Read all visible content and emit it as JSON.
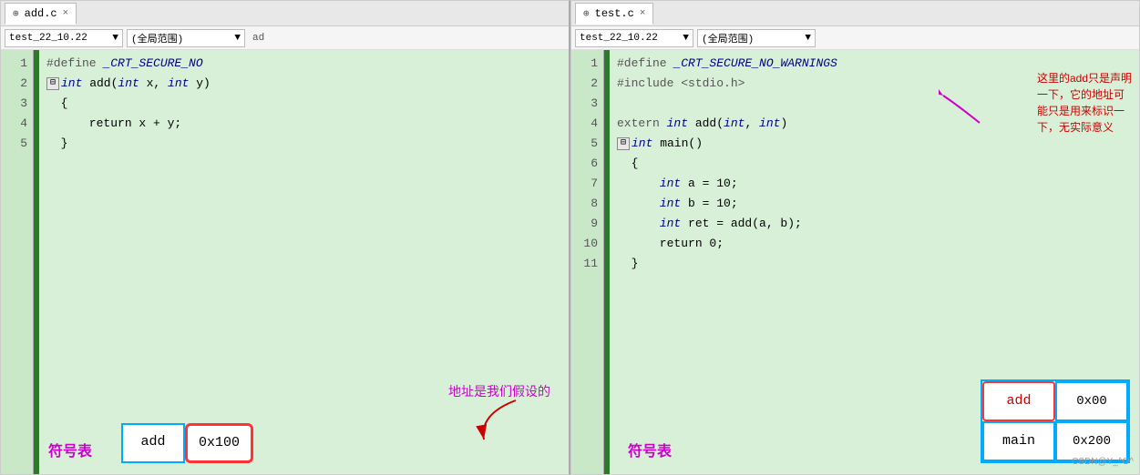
{
  "left_panel": {
    "tab_label": "add.c",
    "tab_pin": "⊕",
    "tab_close": "×",
    "toolbar_dropdown1": "test_22_10.22",
    "toolbar_dropdown1_arrow": "▼",
    "toolbar_dropdown2": "(全局范围)",
    "toolbar_dropdown2_arrow": "▼",
    "toolbar_breadcrumb": "ad",
    "lines": [
      {
        "num": "1",
        "code": "#define _CRT_SECURE_NO"
      },
      {
        "num": "2",
        "code": "⊟ int add(int x, int y)"
      },
      {
        "num": "3",
        "code": "  {"
      },
      {
        "num": "4",
        "code": "      return x + y;"
      },
      {
        "num": "5",
        "code": "  }"
      }
    ],
    "symbol_label": "符号表",
    "st_add": "add",
    "st_addr": "0x100",
    "annotation_text": "地址是我们假设的"
  },
  "right_panel": {
    "tab_label": "test.c",
    "tab_pin": "⊕",
    "tab_close": "×",
    "toolbar_dropdown1": "test_22_10.22",
    "toolbar_dropdown1_arrow": "▼",
    "toolbar_dropdown2": "(全局范围)",
    "toolbar_dropdown2_arrow": "▼",
    "lines": [
      {
        "num": "1",
        "code": "#define _CRT_SECURE_NO_WARNINGS"
      },
      {
        "num": "2",
        "code": "#include <stdio.h>"
      },
      {
        "num": "3",
        "code": ""
      },
      {
        "num": "4",
        "code": "extern int add(int, int)"
      },
      {
        "num": "5",
        "code": "⊟ int main()"
      },
      {
        "num": "6",
        "code": "  {"
      },
      {
        "num": "7",
        "code": "      int a = 10;"
      },
      {
        "num": "8",
        "code": "      int b = 10;"
      },
      {
        "num": "9",
        "code": "      int ret = add(a, b);"
      },
      {
        "num": "10",
        "code": "      return 0;"
      },
      {
        "num": "11",
        "code": "  }"
      }
    ],
    "comment1": "这里的add只是声明",
    "comment2": "一下，它的地址可",
    "comment3": "能只是用来标识一",
    "comment4": "下，无实际意义",
    "symbol_label": "符号表",
    "st_add": "add",
    "st_add_addr": "0x00",
    "st_main": "main",
    "st_main_addr": "0x200"
  },
  "watermark": "CSDN@Y_^O^"
}
